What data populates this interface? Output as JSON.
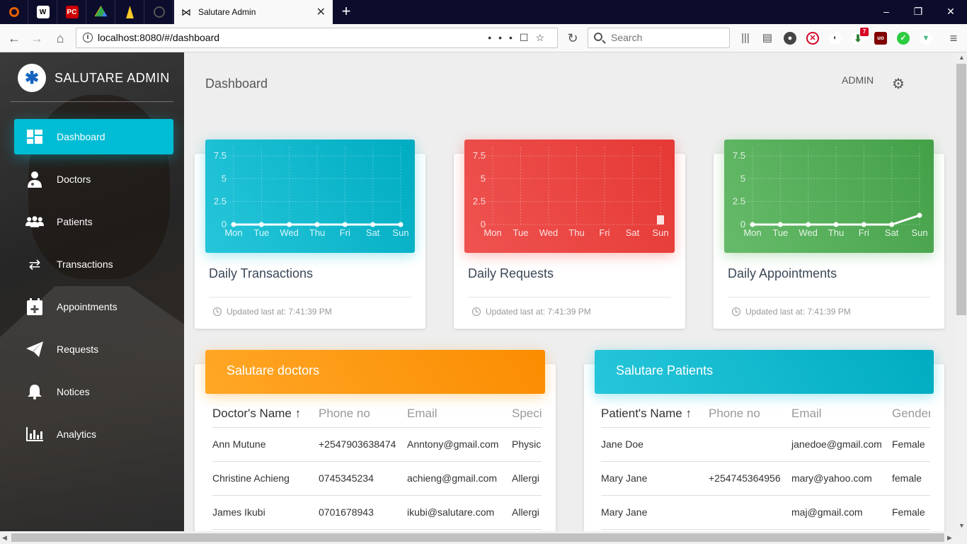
{
  "browser": {
    "tab_title": "Salutare Admin",
    "pinned_tabs": [
      "github-icon",
      "wikipedia-icon",
      "pcgamer-icon",
      "google-drive-icon",
      "firebase-icon",
      "github-icon"
    ],
    "url": "localhost:8080/#/dashboard",
    "search_placeholder": "Search",
    "extension_badge": "7"
  },
  "sidebar": {
    "brand": "SALUTARE ADMIN",
    "items": [
      {
        "label": "Dashboard",
        "icon": "dashboard-icon",
        "active": true
      },
      {
        "label": "Doctors",
        "icon": "doctor-icon"
      },
      {
        "label": "Patients",
        "icon": "people-icon"
      },
      {
        "label": "Transactions",
        "icon": "swap-arrows-icon"
      },
      {
        "label": "Appointments",
        "icon": "calendar-plus-icon"
      },
      {
        "label": "Requests",
        "icon": "send-icon"
      },
      {
        "label": "Notices",
        "icon": "bell-icon"
      },
      {
        "label": "Analytics",
        "icon": "bar-chart-icon"
      }
    ]
  },
  "header": {
    "title": "Dashboard",
    "user": "ADMIN"
  },
  "cards": [
    {
      "title": "Daily Transactions",
      "updated": "Updated last at: 7:41:39 PM",
      "color": "#00bcd4"
    },
    {
      "title": "Daily Requests",
      "updated": "Updated last at: 7:41:39 PM",
      "color": "#f44336"
    },
    {
      "title": "Daily Appointments",
      "updated": "Updated last at: 7:41:39 PM",
      "color": "#4caf50"
    }
  ],
  "chart_data": [
    {
      "type": "line",
      "title": "Daily Transactions",
      "categories": [
        "Mon",
        "Tue",
        "Wed",
        "Thu",
        "Fri",
        "Sat",
        "Sun"
      ],
      "values": [
        0,
        0,
        0,
        0,
        0,
        0,
        0
      ],
      "yticks": [
        "7.5",
        "5",
        "2.5",
        "0"
      ],
      "ylim": [
        0,
        8.5
      ],
      "grid": true
    },
    {
      "type": "bar",
      "title": "Daily Requests",
      "categories": [
        "Mon",
        "Tue",
        "Wed",
        "Thu",
        "Fri",
        "Sat",
        "Sun"
      ],
      "values": [
        0,
        0,
        0,
        0,
        0,
        0,
        1
      ],
      "yticks": [
        "7.5",
        "5",
        "2.5",
        "0"
      ],
      "ylim": [
        0,
        8.5
      ],
      "grid": true
    },
    {
      "type": "line",
      "title": "Daily Appointments",
      "categories": [
        "Mon",
        "Tue",
        "Wed",
        "Thu",
        "Fri",
        "Sat",
        "Sun"
      ],
      "values": [
        0,
        0,
        0,
        0,
        0,
        0,
        1
      ],
      "yticks": [
        "7.5",
        "5",
        "2.5",
        "0"
      ],
      "ylim": [
        0,
        8.5
      ],
      "grid": true
    }
  ],
  "doctors": {
    "title": "Salutare doctors",
    "columns": [
      "Doctor's Name",
      "Phone no",
      "Email",
      "Speci"
    ],
    "rows": [
      [
        "Ann Mutune",
        "+2547903638474",
        "Anntony@gmail.com",
        "Physic"
      ],
      [
        "Christine Achieng",
        "0745345234",
        "achieng@gmail.com",
        "Allergi"
      ],
      [
        "James Ikubi",
        "0701678943",
        "ikubi@salutare.com",
        "Allergi"
      ]
    ]
  },
  "patients": {
    "title": "Salutare Patients",
    "columns": [
      "Patient's Name",
      "Phone no",
      "Email",
      "Gender"
    ],
    "rows": [
      [
        "Jane Doe",
        "",
        "janedoe@gmail.com",
        "Female"
      ],
      [
        "Mary Jane",
        "+254745364956",
        "mary@yahoo.com",
        "female"
      ],
      [
        "Mary Jane",
        "",
        "maj@gmail.com",
        "Female"
      ]
    ]
  }
}
